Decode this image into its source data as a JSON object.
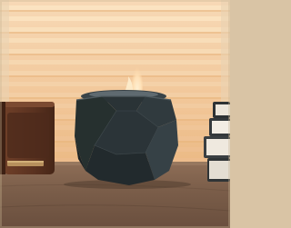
{
  "photo": {
    "subject": "tabletop-fire-bowl",
    "colors": {
      "blind_light": "#fbe3c1",
      "blind_dark": "#e8b47b",
      "bowl": "#2b3438",
      "table": "#7a5d49",
      "radio": "#5a3220",
      "book_pages": "#efe9df"
    }
  }
}
